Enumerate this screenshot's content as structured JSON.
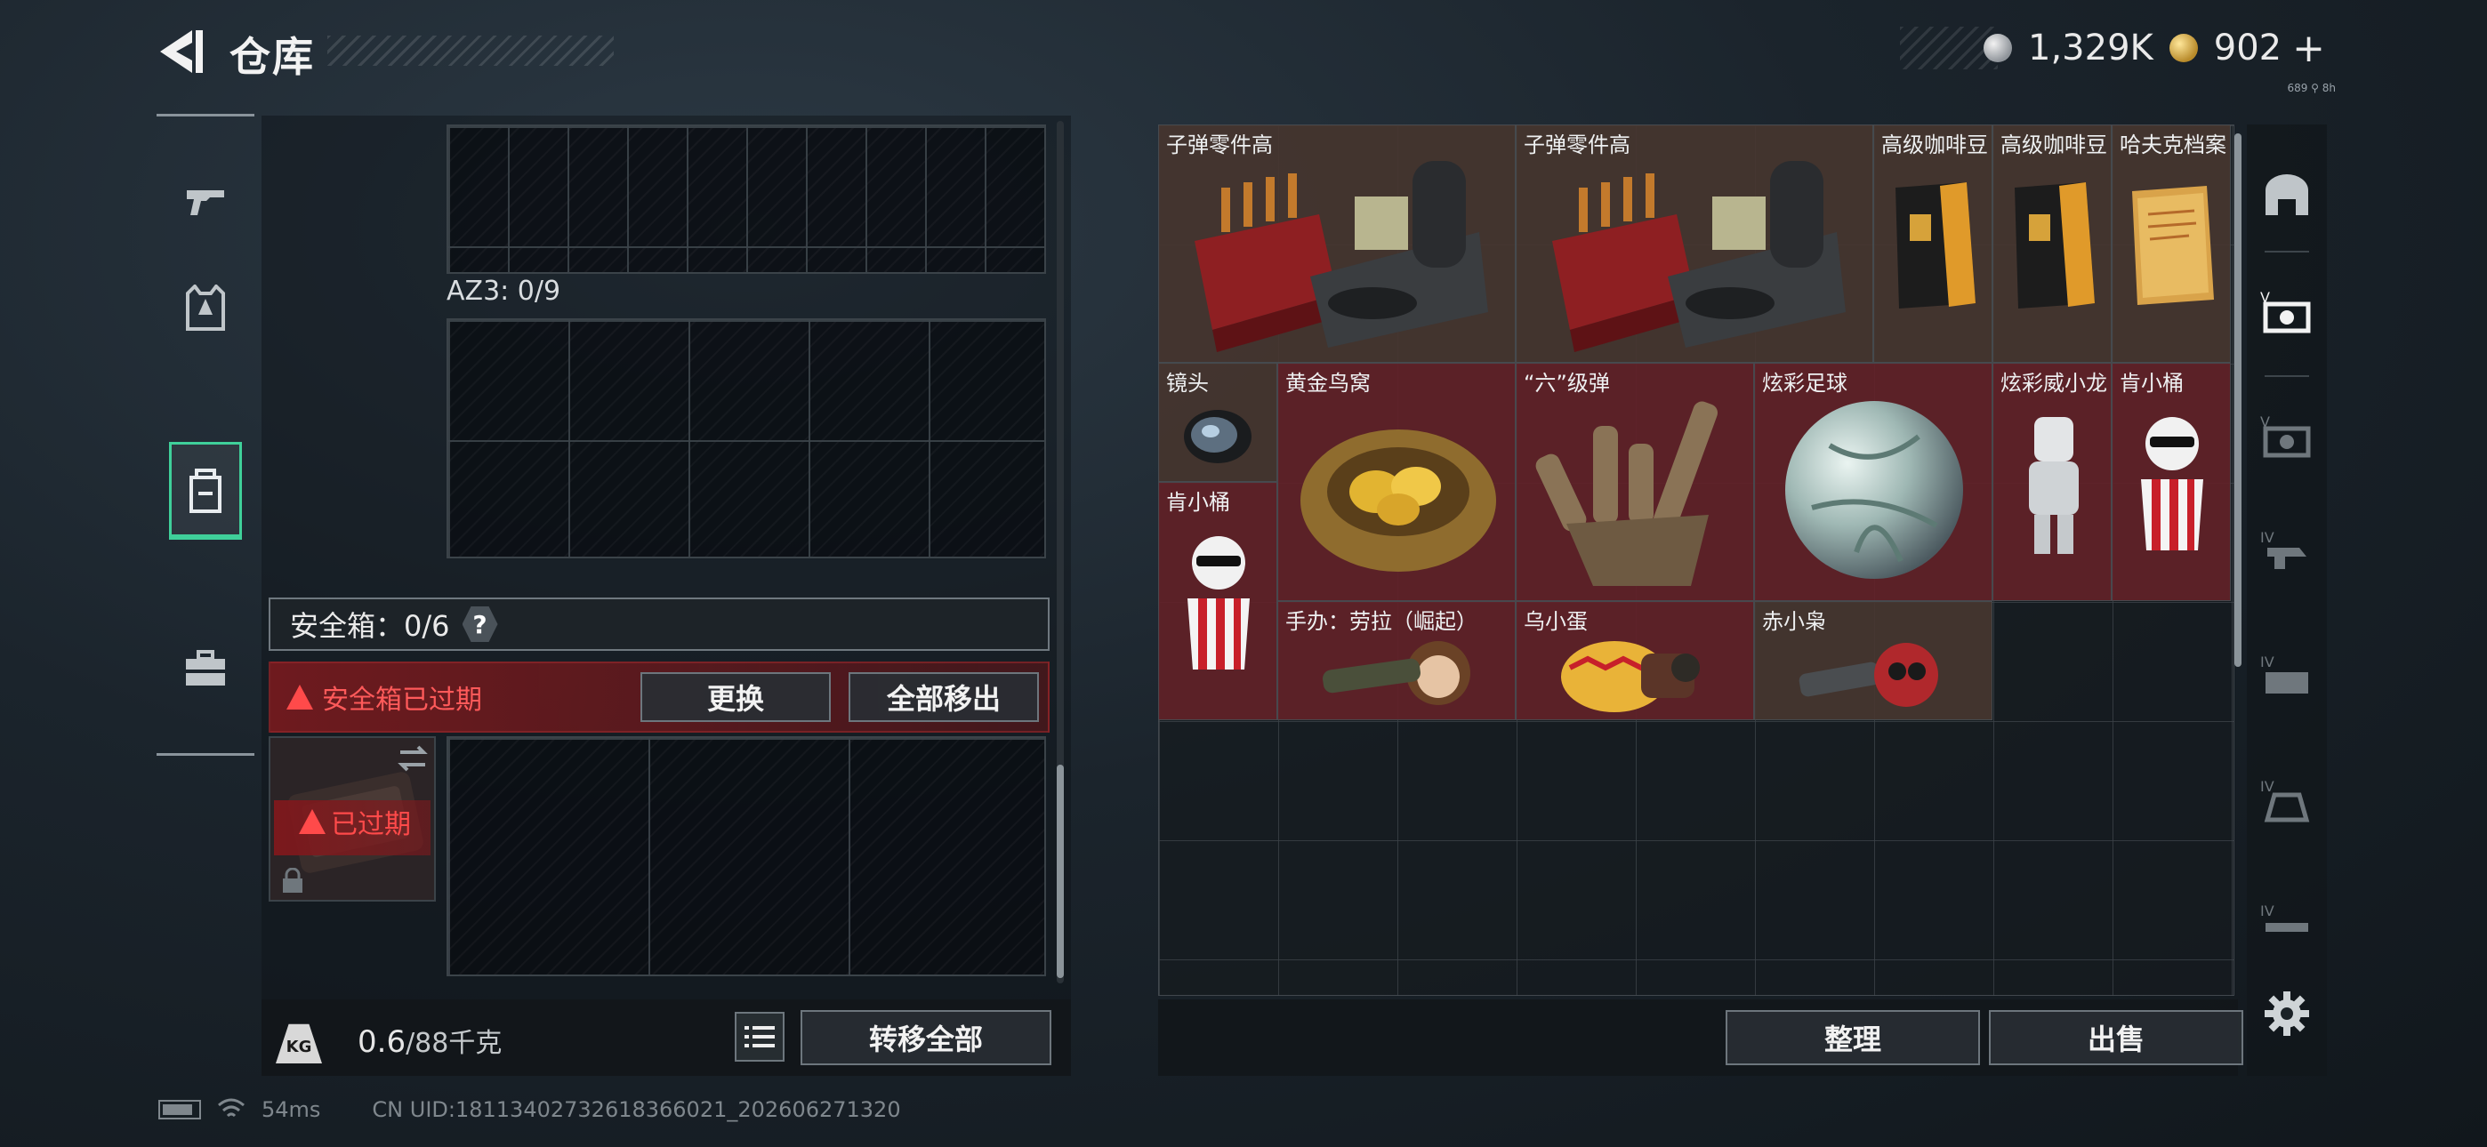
{
  "header": {
    "title": "仓库",
    "currency_1": "1,329K",
    "currency_2": "902",
    "plus_label": "+",
    "tiny_text": "689 ⚲ 8h"
  },
  "left_panel": {
    "az3_label": "AZ3: 0/9",
    "safe_box_label": "安全箱：0/6",
    "help_label": "?",
    "expired_warning": "安全箱已过期",
    "replace_button": "更换",
    "remove_all_button": "全部移出",
    "case_expired": "已过期",
    "weight_value": "0.6",
    "weight_unit": "/88千克",
    "kg_icon_text": "KG",
    "transfer_all_button": "转移全部"
  },
  "inventory": {
    "items": [
      {
        "label": "子弹零件高",
        "bg": "brown"
      },
      {
        "label": "子弹零件高",
        "bg": "brown"
      },
      {
        "label": "高级咖啡豆",
        "bg": "brown"
      },
      {
        "label": "高级咖啡豆",
        "bg": "brown"
      },
      {
        "label": "哈夫克档案",
        "bg": "brown"
      },
      {
        "label": "镜头",
        "bg": "brown"
      },
      {
        "label": "黄金鸟窝",
        "bg": "red"
      },
      {
        "label": "“六”级弹",
        "bg": "red"
      },
      {
        "label": "炫彩足球",
        "bg": "red"
      },
      {
        "label": "炫彩威小龙",
        "bg": "red"
      },
      {
        "label": "肯小桶",
        "bg": "red"
      },
      {
        "label": "肯小桶",
        "bg": "red"
      },
      {
        "label": "手办：劳拉（崛起）",
        "bg": "red"
      },
      {
        "label": "乌小蛋",
        "bg": "red"
      },
      {
        "label": "赤小枭",
        "bg": "brown"
      }
    ],
    "sort_button": "整理",
    "sell_button": "出售"
  },
  "status_bar": {
    "ping": "54ms",
    "uid": "CN UID:1811340273261836602​1_202606271320"
  },
  "colors": {
    "accent_green": "#3fd09a",
    "warning_red": "#ff4a4a",
    "rarity_red": "#622228",
    "rarity_brown": "#463630"
  }
}
